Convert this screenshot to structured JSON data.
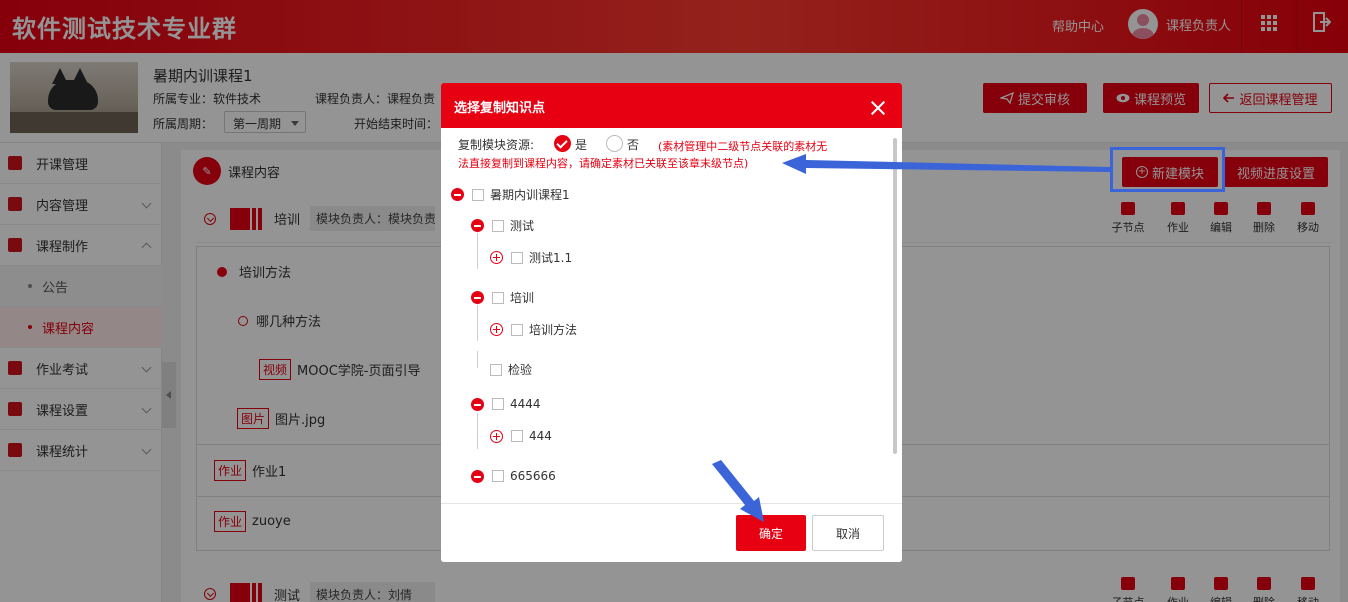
{
  "app": {
    "brand": "软件测试技术专业群",
    "help": "帮助中心",
    "user": "课程负责人"
  },
  "course": {
    "title": "暑期内训课程1",
    "major": "所属专业：软件技术",
    "owner": "课程负责人：课程负责",
    "period_label": "所属周期：",
    "period_value": "第一周期",
    "dates": "开始结束时间：",
    "actions": {
      "submit": "提交审核",
      "preview": "课程预览",
      "back": "返回课程管理"
    }
  },
  "sidebar": {
    "items": [
      {
        "label": "开课管理"
      },
      {
        "label": "内容管理"
      },
      {
        "label": "课程制作"
      },
      {
        "label": "公告"
      },
      {
        "label": "课程内容"
      },
      {
        "label": "作业考试"
      },
      {
        "label": "课程设置"
      },
      {
        "label": "课程统计"
      }
    ]
  },
  "content": {
    "header": "课程内容",
    "new_module": "新建模块",
    "video_settings": "视频进度设置",
    "tools": [
      "子节点",
      "作业",
      "编辑",
      "删除",
      "移动"
    ],
    "modules": [
      {
        "name": "培训",
        "owner": "模块负责人：模块负责"
      },
      {
        "name": "测试",
        "owner": "模块负责人：刘倩"
      }
    ],
    "tree": {
      "n1": "培训方法",
      "n2": "哪几种方法",
      "n3_tag": "视频",
      "n3": "MOOC学院-页面引导",
      "n4_tag": "图片",
      "n4": "图片.jpg",
      "n5_tag": "作业",
      "n5": "作业1",
      "n6_tag": "作业",
      "n6": "zuoye"
    }
  },
  "modal": {
    "title": "选择复制知识点",
    "copy_label": "复制模块资源:",
    "yes": "是",
    "no": "否",
    "note_line1": "(素材管理中二级节点关联的素材无",
    "note_line2": "法直接复制到课程内容，请确定素材已关联至该章末级节点)",
    "tree": [
      {
        "label": "暑期内训课程1"
      },
      {
        "label": "测试"
      },
      {
        "label": "测试1.1"
      },
      {
        "label": "培训"
      },
      {
        "label": "培训方法"
      },
      {
        "label": "检验"
      },
      {
        "label": "4444"
      },
      {
        "label": "444"
      },
      {
        "label": "665666"
      }
    ],
    "ok": "确定",
    "cancel": "取消"
  },
  "colors": {
    "brand_red": "#e60012",
    "annotation_blue": "#3a64d8"
  }
}
